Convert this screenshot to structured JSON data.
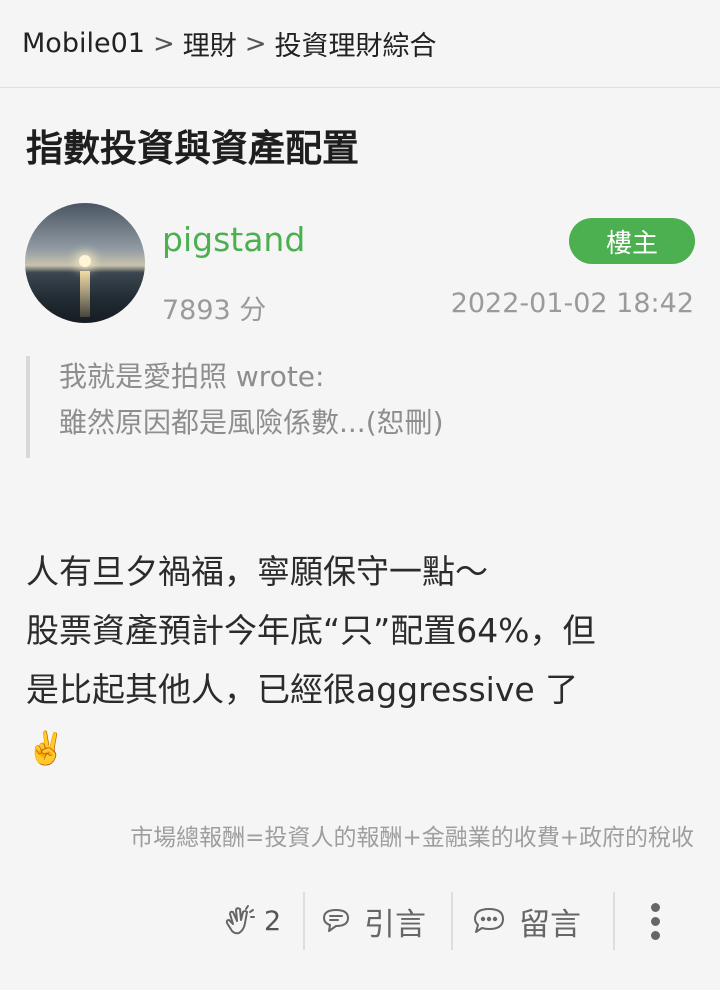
{
  "breadcrumb": {
    "items": [
      "Mobile01",
      "理財",
      "投資理財綜合"
    ],
    "separator": ">"
  },
  "thread": {
    "title": "指數投資與資產配置"
  },
  "post": {
    "author": {
      "username": "pigstand",
      "score": "7893 分",
      "badge": "樓主"
    },
    "timestamp": "2022-01-02 18:42",
    "quote": {
      "author_line": "我就是愛拍照 wrote:",
      "text": "雖然原因都是風險係數...(恕刪)"
    },
    "body": {
      "line1": "人有旦夕禍福，寧願保守一點～",
      "line2": "股票資產預計今年底“只”配置64%，但",
      "line3": "是比起其他人，已經很aggressive 了",
      "emoji": "✌️"
    },
    "signature": "市場總報酬=投資人的報酬+金融業的收費+政府的稅收",
    "actions": {
      "like_count": "2",
      "quote_label": "引言",
      "comment_label": "留言"
    }
  },
  "colors": {
    "accent_green": "#4caf50",
    "background": "#f5f5f5",
    "muted_text": "#9a9a9a"
  },
  "icons": [
    "clap-icon",
    "quote-bubble-icon",
    "comment-bubble-icon",
    "more-vertical-icon"
  ]
}
